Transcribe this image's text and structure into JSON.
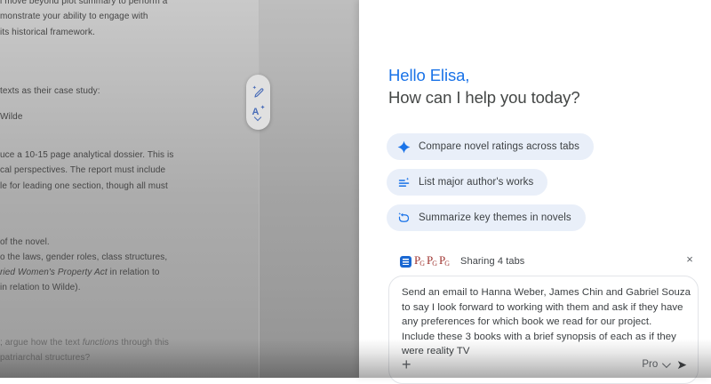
{
  "document": {
    "para1": [
      "l move beyond plot summary to perform a",
      "monstrate your ability to engage with",
      "its historical framework."
    ],
    "line_case_study": "texts as their case study:",
    "line_wilde": "Wilde",
    "para2": [
      "uce a 10-15 page analytical dossier. This is",
      "cal perspectives. The report must include",
      "le for leading one section, though all must"
    ],
    "para3": {
      "line1": "of the novel.",
      "line2": "o the laws, gender roles, class structures,",
      "line3_italic": "ried Women's Property Act",
      "line3_rest": " in relation to",
      "line4": "in relation to Wilde)."
    },
    "para4": {
      "line1_pre": "; argue how the text ",
      "line1_italic": "functions",
      "line1_post": " through this",
      "line2": "patriarchal structures?"
    },
    "side_toolbar_icons": [
      "help-me-write-pencil-sparkle",
      "rewrite-a-sparkle"
    ]
  },
  "panel": {
    "greeting_name": "Hello Elisa,",
    "greeting_question": "How can I help you today?",
    "chips": [
      {
        "icon": "spark-icon",
        "label": "Compare novel ratings across tabs"
      },
      {
        "icon": "list-sparkle-icon",
        "label": "List major author's works"
      },
      {
        "icon": "replay-sparkle-icon",
        "label": "Summarize key themes in novels"
      }
    ],
    "share_bar": {
      "label": "Sharing 4 tabs",
      "favicons": [
        {
          "type": "google-docs"
        },
        {
          "type": "gutenberg",
          "p": "P",
          "g": "G"
        },
        {
          "type": "gutenberg",
          "p": "P",
          "g": "G"
        },
        {
          "type": "gutenberg",
          "p": "P",
          "g": "G"
        }
      ],
      "close_glyph": "×"
    },
    "prompt": {
      "lines": [
        "Send an email to Hanna Weber, James Chin and Gabriel Souza",
        "to say I look forward to working with them and ask if they have",
        "any preferences for which book we read for our project.",
        "Include these 3 books with a brief synopsis of each as if they",
        "were reality TV"
      ],
      "plus_glyph": "+",
      "model_label": "Pro",
      "send_glyph": "➤"
    }
  },
  "colors": {
    "accent_blue": "#1a73e8",
    "chip_bg": "#e9eff9",
    "heading_gray": "#444746",
    "gutenberg_red": "#9e3430"
  }
}
